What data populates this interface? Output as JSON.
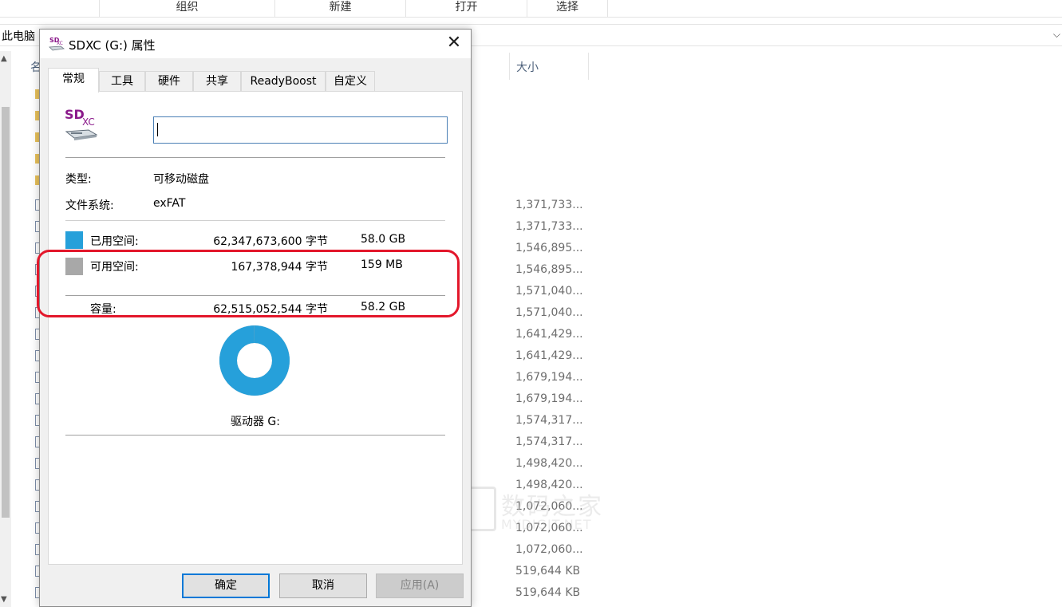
{
  "explorer": {
    "ribbon_groups": [
      "组织",
      "新建",
      "打开",
      "选择"
    ],
    "breadcrumb": "此电脑",
    "name_header": "名",
    "size_header": "大小",
    "sizes": [
      "1,371,733...",
      "1,371,733...",
      "1,546,895...",
      "1,546,895...",
      "1,571,040...",
      "1,571,040...",
      "1,641,429...",
      "1,641,429...",
      "1,679,194...",
      "1,679,194...",
      "1,574,317...",
      "1,574,317...",
      "1,498,420...",
      "1,498,420...",
      "1,072,060...",
      "1,072,060...",
      "1,072,060...",
      "519,644 KB",
      "519,644 KB"
    ],
    "watermark_line1": "数码之家",
    "watermark_line2": "MYDIGIT.NET"
  },
  "dialog": {
    "title": "SDXC (G:) 属性",
    "close_glyph": "✕",
    "tabs": [
      "常规",
      "工具",
      "硬件",
      "共享",
      "ReadyBoost",
      "自定义"
    ],
    "active_tab": "常规",
    "icon_text_top": "SD",
    "icon_text_sub": "XC",
    "volume_name": "",
    "type_label": "类型:",
    "type_value": "可移动磁盘",
    "fs_label": "文件系统:",
    "fs_value": "exFAT",
    "used_label": "已用空间:",
    "used_bytes": "62,347,673,600 字节",
    "used_human": "58.0 GB",
    "free_label": "可用空间:",
    "free_bytes": "167,378,944 字节",
    "free_human": "159 MB",
    "capacity_label": "容量:",
    "capacity_bytes": "62,515,052,544 字节",
    "capacity_human": "58.2 GB",
    "used_fraction": 0.9973,
    "drive_label": "驱动器 G:",
    "buttons": {
      "ok": "确定",
      "cancel": "取消",
      "apply": "应用(A)"
    },
    "colors": {
      "used": "#26a0da",
      "free": "#a8a8a8",
      "highlight": "#e3172b",
      "accent": "#0078d7"
    }
  }
}
